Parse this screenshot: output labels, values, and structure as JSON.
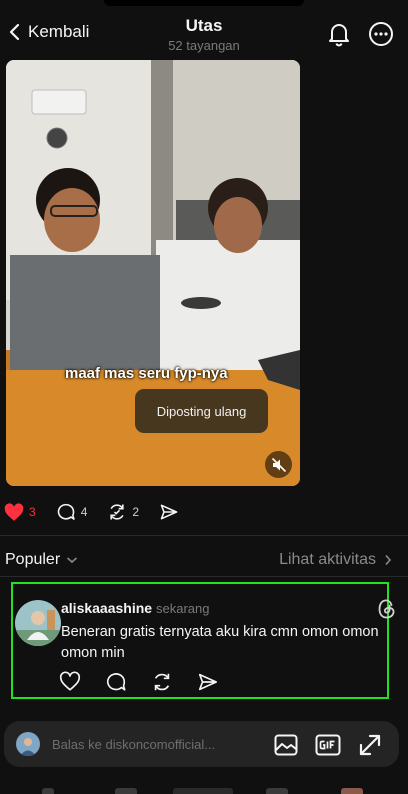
{
  "header": {
    "back_label": "Kembali",
    "title": "Utas",
    "views": "52 tayangan"
  },
  "post": {
    "caption": "maaf mas seru fyp-nya",
    "toast": "Diposting ulang",
    "likes": "3",
    "comments": "4",
    "reposts": "2",
    "liked_color": "#ff3040"
  },
  "section": {
    "sort_label": "Populer",
    "activity_label": "Lihat aktivitas"
  },
  "reply": {
    "username": "aliskaaashine",
    "time": "sekarang",
    "text": "Beneran gratis ternyata aku kira cmn omon omon omon min"
  },
  "composer": {
    "placeholder": "Balas ke diskoncomofficial..."
  },
  "colors": {
    "highlight_border": "#22e022",
    "background": "#101010"
  }
}
